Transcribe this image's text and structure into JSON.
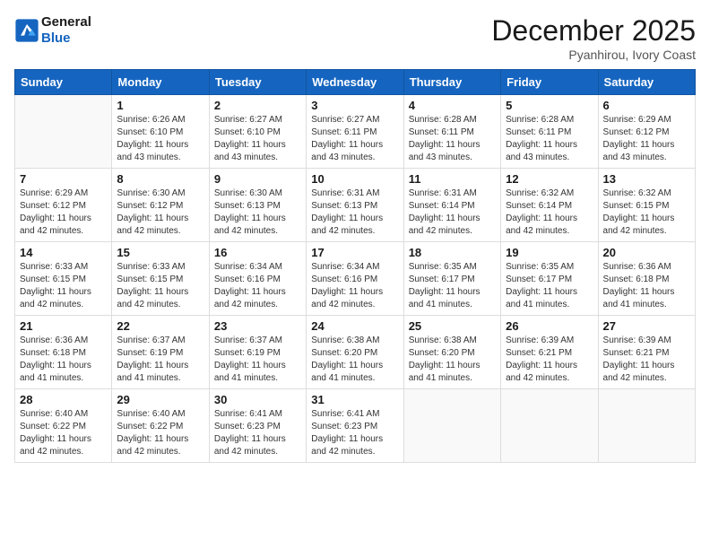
{
  "header": {
    "logo_line1": "General",
    "logo_line2": "Blue",
    "month_title": "December 2025",
    "location": "Pyanhirou, Ivory Coast"
  },
  "columns": [
    "Sunday",
    "Monday",
    "Tuesday",
    "Wednesday",
    "Thursday",
    "Friday",
    "Saturday"
  ],
  "weeks": [
    [
      {
        "day": "",
        "info": ""
      },
      {
        "day": "1",
        "info": "Sunrise: 6:26 AM\nSunset: 6:10 PM\nDaylight: 11 hours\nand 43 minutes."
      },
      {
        "day": "2",
        "info": "Sunrise: 6:27 AM\nSunset: 6:10 PM\nDaylight: 11 hours\nand 43 minutes."
      },
      {
        "day": "3",
        "info": "Sunrise: 6:27 AM\nSunset: 6:11 PM\nDaylight: 11 hours\nand 43 minutes."
      },
      {
        "day": "4",
        "info": "Sunrise: 6:28 AM\nSunset: 6:11 PM\nDaylight: 11 hours\nand 43 minutes."
      },
      {
        "day": "5",
        "info": "Sunrise: 6:28 AM\nSunset: 6:11 PM\nDaylight: 11 hours\nand 43 minutes."
      },
      {
        "day": "6",
        "info": "Sunrise: 6:29 AM\nSunset: 6:12 PM\nDaylight: 11 hours\nand 43 minutes."
      }
    ],
    [
      {
        "day": "7",
        "info": "Sunrise: 6:29 AM\nSunset: 6:12 PM\nDaylight: 11 hours\nand 42 minutes."
      },
      {
        "day": "8",
        "info": "Sunrise: 6:30 AM\nSunset: 6:12 PM\nDaylight: 11 hours\nand 42 minutes."
      },
      {
        "day": "9",
        "info": "Sunrise: 6:30 AM\nSunset: 6:13 PM\nDaylight: 11 hours\nand 42 minutes."
      },
      {
        "day": "10",
        "info": "Sunrise: 6:31 AM\nSunset: 6:13 PM\nDaylight: 11 hours\nand 42 minutes."
      },
      {
        "day": "11",
        "info": "Sunrise: 6:31 AM\nSunset: 6:14 PM\nDaylight: 11 hours\nand 42 minutes."
      },
      {
        "day": "12",
        "info": "Sunrise: 6:32 AM\nSunset: 6:14 PM\nDaylight: 11 hours\nand 42 minutes."
      },
      {
        "day": "13",
        "info": "Sunrise: 6:32 AM\nSunset: 6:15 PM\nDaylight: 11 hours\nand 42 minutes."
      }
    ],
    [
      {
        "day": "14",
        "info": "Sunrise: 6:33 AM\nSunset: 6:15 PM\nDaylight: 11 hours\nand 42 minutes."
      },
      {
        "day": "15",
        "info": "Sunrise: 6:33 AM\nSunset: 6:15 PM\nDaylight: 11 hours\nand 42 minutes."
      },
      {
        "day": "16",
        "info": "Sunrise: 6:34 AM\nSunset: 6:16 PM\nDaylight: 11 hours\nand 42 minutes."
      },
      {
        "day": "17",
        "info": "Sunrise: 6:34 AM\nSunset: 6:16 PM\nDaylight: 11 hours\nand 42 minutes."
      },
      {
        "day": "18",
        "info": "Sunrise: 6:35 AM\nSunset: 6:17 PM\nDaylight: 11 hours\nand 41 minutes."
      },
      {
        "day": "19",
        "info": "Sunrise: 6:35 AM\nSunset: 6:17 PM\nDaylight: 11 hours\nand 41 minutes."
      },
      {
        "day": "20",
        "info": "Sunrise: 6:36 AM\nSunset: 6:18 PM\nDaylight: 11 hours\nand 41 minutes."
      }
    ],
    [
      {
        "day": "21",
        "info": "Sunrise: 6:36 AM\nSunset: 6:18 PM\nDaylight: 11 hours\nand 41 minutes."
      },
      {
        "day": "22",
        "info": "Sunrise: 6:37 AM\nSunset: 6:19 PM\nDaylight: 11 hours\nand 41 minutes."
      },
      {
        "day": "23",
        "info": "Sunrise: 6:37 AM\nSunset: 6:19 PM\nDaylight: 11 hours\nand 41 minutes."
      },
      {
        "day": "24",
        "info": "Sunrise: 6:38 AM\nSunset: 6:20 PM\nDaylight: 11 hours\nand 41 minutes."
      },
      {
        "day": "25",
        "info": "Sunrise: 6:38 AM\nSunset: 6:20 PM\nDaylight: 11 hours\nand 41 minutes."
      },
      {
        "day": "26",
        "info": "Sunrise: 6:39 AM\nSunset: 6:21 PM\nDaylight: 11 hours\nand 42 minutes."
      },
      {
        "day": "27",
        "info": "Sunrise: 6:39 AM\nSunset: 6:21 PM\nDaylight: 11 hours\nand 42 minutes."
      }
    ],
    [
      {
        "day": "28",
        "info": "Sunrise: 6:40 AM\nSunset: 6:22 PM\nDaylight: 11 hours\nand 42 minutes."
      },
      {
        "day": "29",
        "info": "Sunrise: 6:40 AM\nSunset: 6:22 PM\nDaylight: 11 hours\nand 42 minutes."
      },
      {
        "day": "30",
        "info": "Sunrise: 6:41 AM\nSunset: 6:23 PM\nDaylight: 11 hours\nand 42 minutes."
      },
      {
        "day": "31",
        "info": "Sunrise: 6:41 AM\nSunset: 6:23 PM\nDaylight: 11 hours\nand 42 minutes."
      },
      {
        "day": "",
        "info": ""
      },
      {
        "day": "",
        "info": ""
      },
      {
        "day": "",
        "info": ""
      }
    ]
  ]
}
